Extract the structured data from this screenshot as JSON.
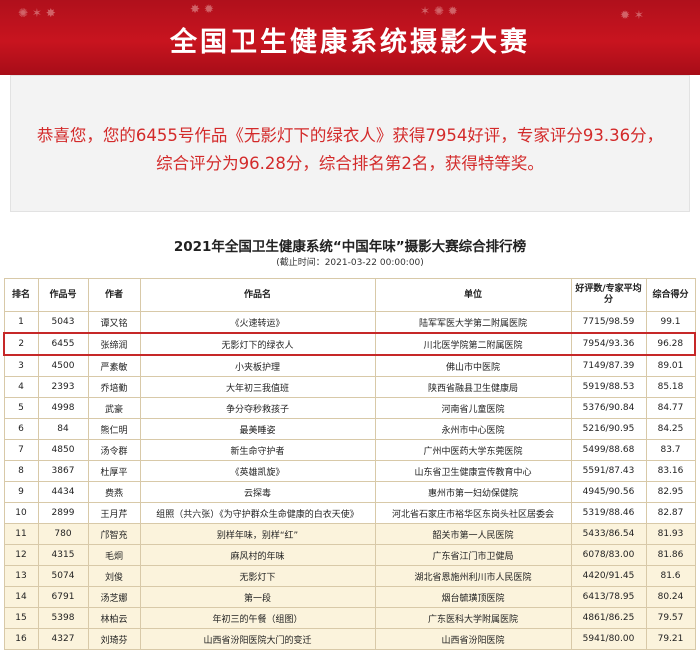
{
  "banner": {
    "title": "全国卫生健康系统摄影大赛"
  },
  "award": {
    "message": "恭喜您，您的6455号作品《无影灯下的绿衣人》获得7954好评，专家评分93.36分，综合评分为96.28分，综合排名第2名，获得特等奖。"
  },
  "leaderboard": {
    "title": "2021年全国卫生健康系统“中国年味”摄影大赛综合排行榜",
    "subtitle": "(截止时间：2021-03-22 00:00:00)",
    "headers": {
      "rank": "排名",
      "work_no": "作品号",
      "author": "作者",
      "work": "作品名",
      "unit": "单位",
      "score": "好评数/专家平均分",
      "total": "综合得分"
    },
    "rows": [
      {
        "rank": "1",
        "no": "5043",
        "author": "谭又铭",
        "work": "《火速转运》",
        "unit": "陆军军医大学第二附属医院",
        "score": "7715/98.59",
        "total": "99.1"
      },
      {
        "rank": "2",
        "no": "6455",
        "author": "张缔润",
        "work": "无影灯下的绿衣人",
        "unit": "川北医学院第二附属医院",
        "score": "7954/93.36",
        "total": "96.28"
      },
      {
        "rank": "3",
        "no": "4500",
        "author": "严素敏",
        "work": "小夹板护理",
        "unit": "佛山市中医院",
        "score": "7149/87.39",
        "total": "89.01"
      },
      {
        "rank": "4",
        "no": "2393",
        "author": "乔培勤",
        "work": "大年初三我值班",
        "unit": "陕西省融县卫生健康局",
        "score": "5919/88.53",
        "total": "85.18"
      },
      {
        "rank": "5",
        "no": "4998",
        "author": "武豪",
        "work": "争分夺秒救孩子",
        "unit": "河南省儿童医院",
        "score": "5376/90.84",
        "total": "84.77"
      },
      {
        "rank": "6",
        "no": "84",
        "author": "熊仁明",
        "work": "最美睡姿",
        "unit": "永州市中心医院",
        "score": "5216/90.95",
        "total": "84.25"
      },
      {
        "rank": "7",
        "no": "4850",
        "author": "汤令群",
        "work": "新生命守护者",
        "unit": "广州中医药大学东莞医院",
        "score": "5499/88.68",
        "total": "83.7"
      },
      {
        "rank": "8",
        "no": "3867",
        "author": "杜厚平",
        "work": "《英雄凯旋》",
        "unit": "山东省卫生健康宣传教育中心",
        "score": "5591/87.43",
        "total": "83.16"
      },
      {
        "rank": "9",
        "no": "4434",
        "author": "费燕",
        "work": "云探毒",
        "unit": "惠州市第一妇幼保健院",
        "score": "4945/90.56",
        "total": "82.95"
      },
      {
        "rank": "10",
        "no": "2899",
        "author": "王月芹",
        "work": "组照（共六张）《为守护群众生命健康的白衣天使》",
        "unit": "河北省石家庄市裕华区东岗头社区居委会",
        "score": "5319/88.46",
        "total": "82.87"
      },
      {
        "rank": "11",
        "no": "780",
        "author": "邝智充",
        "work": "别样年味，别样“红”",
        "unit": "韶关市第一人民医院",
        "score": "5433/86.54",
        "total": "81.93"
      },
      {
        "rank": "12",
        "no": "4315",
        "author": "毛炯",
        "work": "麻风村的年味",
        "unit": "广东省江门市卫健局",
        "score": "6078/83.00",
        "total": "81.86"
      },
      {
        "rank": "13",
        "no": "5074",
        "author": "刘俊",
        "work": "无影灯下",
        "unit": "湖北省恩施州利川市人民医院",
        "score": "4420/91.45",
        "total": "81.6"
      },
      {
        "rank": "14",
        "no": "6791",
        "author": "汤芝娜",
        "work": "第一段",
        "unit": "烟台毓璜顶医院",
        "score": "6413/78.95",
        "total": "80.24"
      },
      {
        "rank": "15",
        "no": "5398",
        "author": "林柏云",
        "work": "年初三的午餐（组图）",
        "unit": "广东医科大学附属医院",
        "score": "4861/86.25",
        "total": "79.57"
      },
      {
        "rank": "16",
        "no": "4327",
        "author": "刘琦芬",
        "work": "山西省汾阳医院大门的变迁",
        "unit": "山西省汾阳医院",
        "score": "5941/80.00",
        "total": "79.21"
      }
    ]
  },
  "colors": {
    "banner_red": "#c8141f",
    "award_text": "#d32a2a",
    "highlight_border": "#c62828",
    "row_cream": "#fbf3dc"
  }
}
